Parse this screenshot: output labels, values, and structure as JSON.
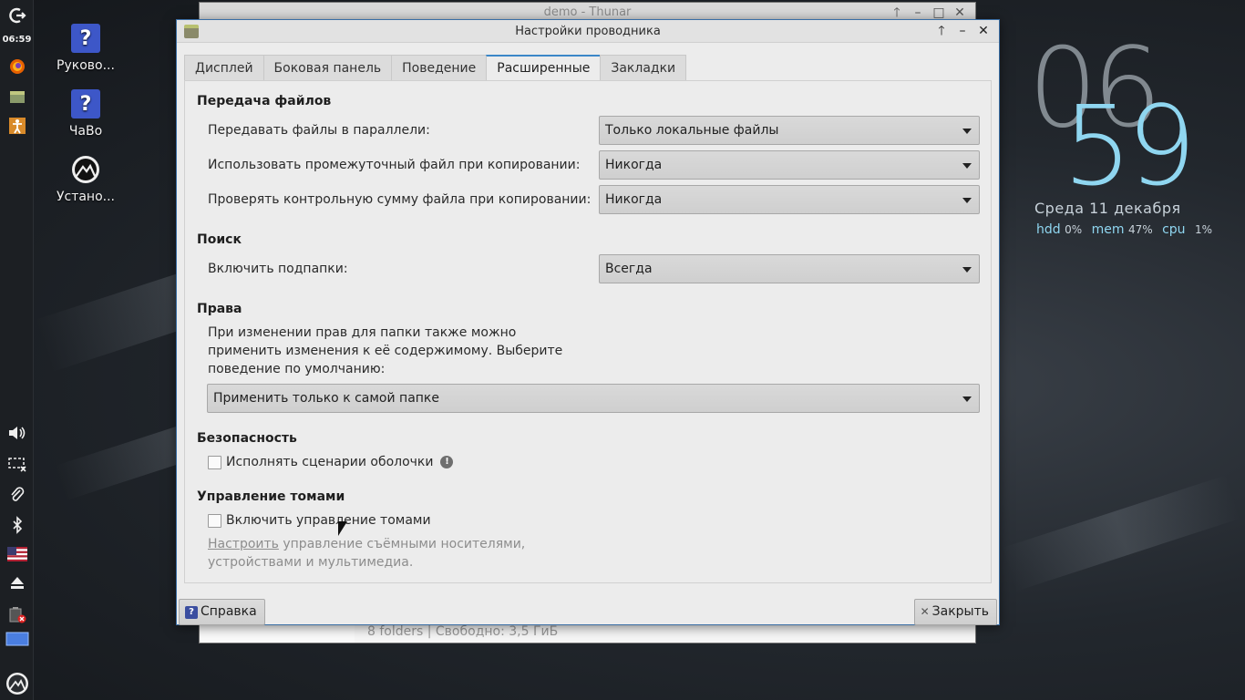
{
  "panel": {
    "time": "06:59",
    "icons": [
      "logout-icon",
      "firefox-icon",
      "file-manager-icon",
      "accessibility-icon",
      "volume-icon",
      "display-icon",
      "clipboard-icon",
      "bluetooth-icon",
      "us-flag-icon",
      "eject-icon",
      "battery-icon",
      "workspace-icon",
      "distro-logo-icon"
    ]
  },
  "desktop": {
    "icons": [
      {
        "label": "Руково..."
      },
      {
        "label": "ЧаВо"
      },
      {
        "label": "Устано..."
      }
    ]
  },
  "conky": {
    "hour": "06",
    "minute": "59",
    "date": "Среда  11 декабря",
    "hdd_label": "hdd",
    "hdd_value": "0%",
    "mem_label": "mem",
    "mem_value": "47%",
    "cpu_label": "cpu",
    "cpu_value": "1%"
  },
  "background_window": {
    "title": "demo - Thunar",
    "status": "8 folders  |  Свободно: 3,5 ГиБ"
  },
  "dialog": {
    "title": "Настройки проводника",
    "tabs": [
      {
        "label": "Дисплей"
      },
      {
        "label": "Боковая панель"
      },
      {
        "label": "Поведение"
      },
      {
        "label": "Расширенные"
      },
      {
        "label": "Закладки"
      }
    ],
    "active_tab": "Расширенные",
    "file_transfer": {
      "title": "Передача файлов",
      "parallel_label": "Передавать файлы в параллели:",
      "parallel_value": "Только локальные файлы",
      "intermediate_label": "Использовать промежуточный файл при копировании:",
      "intermediate_value": "Никогда",
      "checksum_label": "Проверять контрольную сумму файла при копировании:",
      "checksum_value": "Никогда"
    },
    "search": {
      "title": "Поиск",
      "subfolders_label": "Включить подпапки:",
      "subfolders_value": "Всегда"
    },
    "permissions": {
      "title": "Права",
      "description_1": "При изменении прав для папки также можно",
      "description_2": "применить изменения к её содержимому. Выберите",
      "description_3": "поведение по умолчанию:",
      "value": "Применить только к самой папке"
    },
    "security": {
      "title": "Безопасность",
      "shell_scripts_label": "Исполнять сценарии оболочки"
    },
    "volume_management": {
      "title": "Управление томами",
      "enable_label": "Включить управление томами",
      "configure_link": "Настроить",
      "configure_text_1": " управление съёмными носителями,",
      "configure_text_2": "устройствами и мультимедиа."
    },
    "help_button": "Справка",
    "close_button": "Закрыть"
  }
}
